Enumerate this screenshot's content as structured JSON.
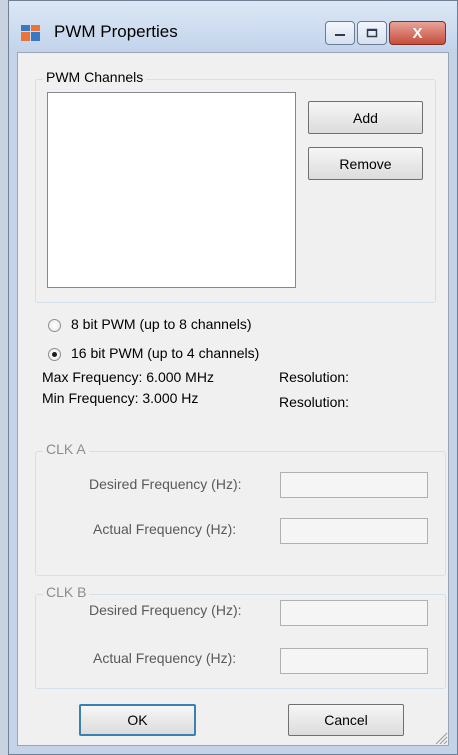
{
  "window": {
    "title": "PWM Properties",
    "close_glyph": "X"
  },
  "channels_group": {
    "label": "PWM Channels",
    "add_label": "Add",
    "remove_label": "Remove",
    "items": []
  },
  "mode": {
    "option_8bit": "8 bit PWM (up to 8 channels)",
    "option_16bit": "16 bit PWM (up to 4 channels)",
    "selected": "16bit"
  },
  "freq_info": {
    "max_label": "Max Frequency: 6.000 MHz",
    "min_label": "Min Frequency: 3.000 Hz",
    "resolution_label_1": "Resolution:",
    "resolution_label_2": "Resolution:"
  },
  "clk_a": {
    "label": "CLK A",
    "desired_label": "Desired Frequency (Hz):",
    "actual_label": "Actual Frequency (Hz):",
    "desired_value": "",
    "actual_value": ""
  },
  "clk_b": {
    "label": "CLK B",
    "desired_label": "Desired Frequency (Hz):",
    "actual_label": "Actual Frequency (Hz):",
    "desired_value": "",
    "actual_value": ""
  },
  "footer": {
    "ok_label": "OK",
    "cancel_label": "Cancel"
  }
}
